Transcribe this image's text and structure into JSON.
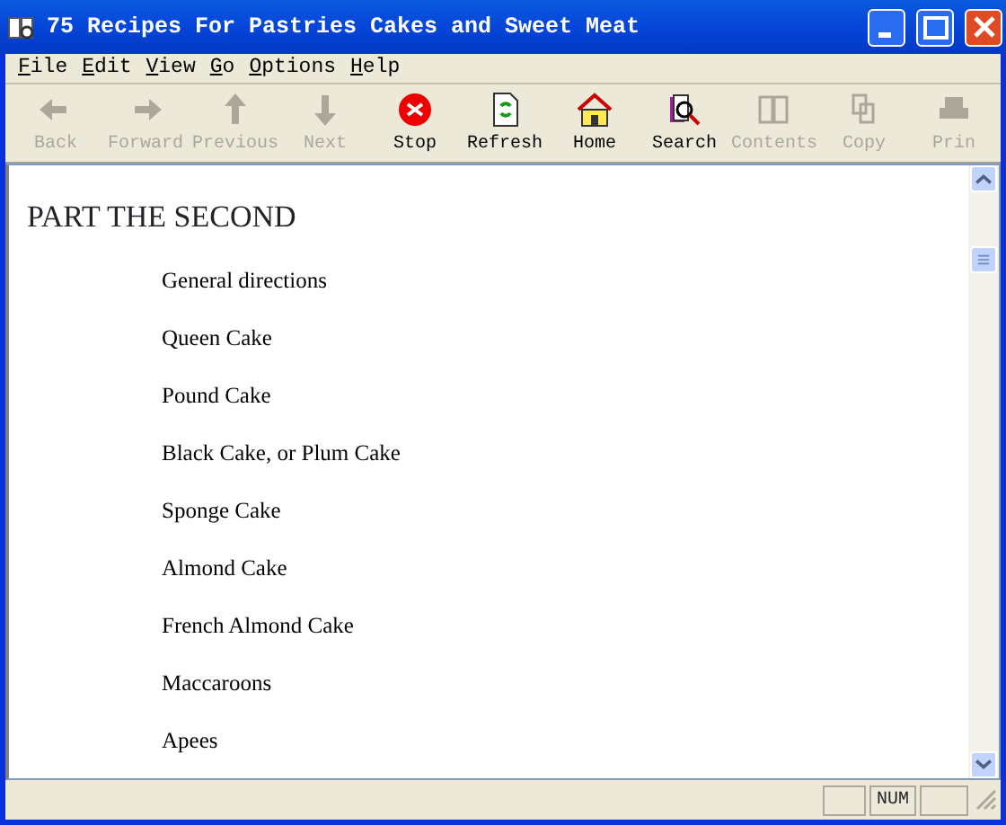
{
  "window": {
    "title": "75 Recipes For Pastries Cakes and Sweet Meat"
  },
  "menu": [
    "File",
    "Edit",
    "View",
    "Go",
    "Options",
    "Help"
  ],
  "toolbar": [
    {
      "kind": "back",
      "label": "Back",
      "disabled": true
    },
    {
      "kind": "forward",
      "label": "Forward",
      "disabled": true
    },
    {
      "kind": "previous",
      "label": "Previous",
      "disabled": true
    },
    {
      "kind": "next",
      "label": "Next",
      "disabled": true
    },
    {
      "kind": "stop",
      "label": "Stop",
      "disabled": false
    },
    {
      "kind": "refresh",
      "label": "Refresh",
      "disabled": false
    },
    {
      "kind": "home",
      "label": "Home",
      "disabled": false
    },
    {
      "kind": "search",
      "label": "Search",
      "disabled": false
    },
    {
      "kind": "contents",
      "label": "Contents",
      "disabled": true
    },
    {
      "kind": "copy",
      "label": "Copy",
      "disabled": true
    },
    {
      "kind": "print",
      "label": "Prin",
      "disabled": true
    }
  ],
  "document": {
    "heading": "PART THE SECOND",
    "links": [
      "General directions",
      "Queen Cake",
      "Pound Cake",
      "Black Cake, or Plum Cake",
      "Sponge Cake",
      "Almond Cake",
      "French Almond Cake",
      "Maccaroons",
      "Apees"
    ]
  },
  "status_bar": {
    "indicator": "NUM"
  }
}
